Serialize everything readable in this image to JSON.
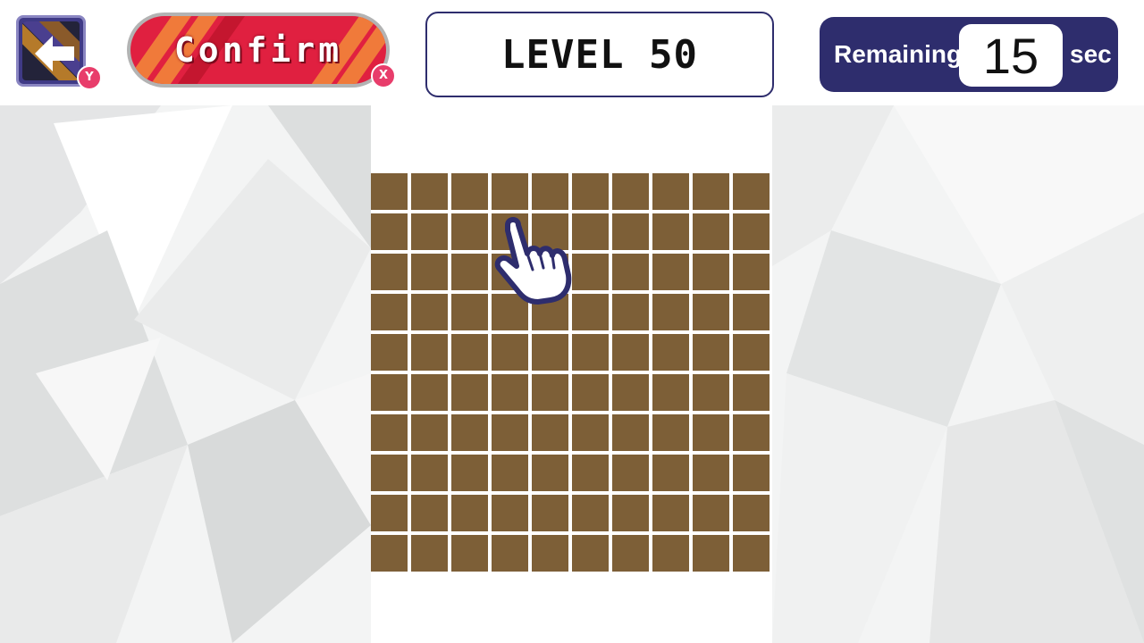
{
  "header": {
    "back_badge": "Y",
    "confirm_label": "Confirm",
    "confirm_badge": "X",
    "level_title": "LEVEL 50",
    "timer": {
      "prefix": "Remaining",
      "value": "15",
      "suffix": "sec"
    }
  },
  "board": {
    "rows": 10,
    "cols": 10,
    "cell_color": "#7d5f37"
  },
  "colors": {
    "accent_navy": "#2e2d6d",
    "confirm_red": "#e02040",
    "badge_pink": "#e83d6b"
  },
  "icons": {
    "back": "arrow-left-icon",
    "pointer": "hand-pointer-icon"
  }
}
